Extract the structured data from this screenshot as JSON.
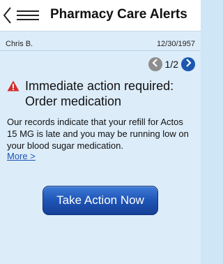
{
  "header": {
    "title": "Pharmacy Care Alerts",
    "back_icon": "back-menu-icon"
  },
  "patient": {
    "name": "Chris B.",
    "dob": "12/30/1957"
  },
  "pager": {
    "count": "1/2",
    "prev_icon": "chevron-left-icon",
    "next_icon": "chevron-right-icon"
  },
  "alert": {
    "icon": "warning-icon",
    "title": "Immediate action required:",
    "subtitle": "Order medication",
    "message": "Our records indicate that your refill for Actos 15 MG is late and you may be running low on your blood sugar medication.",
    "more_label": "More >"
  },
  "action": {
    "label": "Take Action Now"
  },
  "colors": {
    "accent": "#1f55b6",
    "background": "#dcecf9",
    "warning": "#d62b2b"
  }
}
